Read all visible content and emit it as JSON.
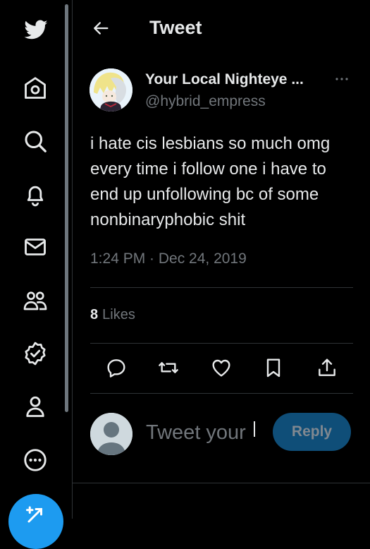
{
  "nav": {
    "items": [
      {
        "name": "twitter-logo",
        "icon": "twitter-bird-icon"
      },
      {
        "name": "home",
        "icon": "home-icon"
      },
      {
        "name": "explore",
        "icon": "search-icon"
      },
      {
        "name": "notifications",
        "icon": "bell-icon"
      },
      {
        "name": "messages",
        "icon": "mail-icon"
      },
      {
        "name": "communities",
        "icon": "people-icon"
      },
      {
        "name": "verified",
        "icon": "verified-badge-icon"
      },
      {
        "name": "profile",
        "icon": "person-icon"
      },
      {
        "name": "more",
        "icon": "more-circle-icon"
      }
    ],
    "compose_icon": "compose-feather-icon"
  },
  "header": {
    "back_icon": "arrow-left-icon",
    "title": "Tweet"
  },
  "tweet": {
    "author": {
      "display_name": "Your Local Nighteye ...",
      "handle": "@hybrid_empress"
    },
    "more_icon": "more-horizontal-icon",
    "text_lines": [
      "i hate cis lesbians so much omg",
      "every time i follow one i have to",
      "end up unfollowing bc of some",
      "nonbinaryphobic shit"
    ],
    "timestamp": "1:24 PM · Dec 24, 2019",
    "likes_count": "8",
    "likes_label": "Likes",
    "actions": [
      {
        "name": "reply",
        "icon": "comment-icon"
      },
      {
        "name": "retweet",
        "icon": "retweet-icon"
      },
      {
        "name": "like",
        "icon": "heart-icon"
      },
      {
        "name": "bookmark",
        "icon": "bookmark-icon"
      },
      {
        "name": "share",
        "icon": "share-icon"
      }
    ]
  },
  "reply_box": {
    "placeholder": "Tweet your",
    "button_label": "Reply"
  },
  "colors": {
    "background": "#000000",
    "text_primary": "#e7e9ea",
    "text_secondary": "#71767b",
    "accent": "#1d9bf0",
    "divider": "#2f3336",
    "reply_button_disabled": "#0f4e78"
  }
}
